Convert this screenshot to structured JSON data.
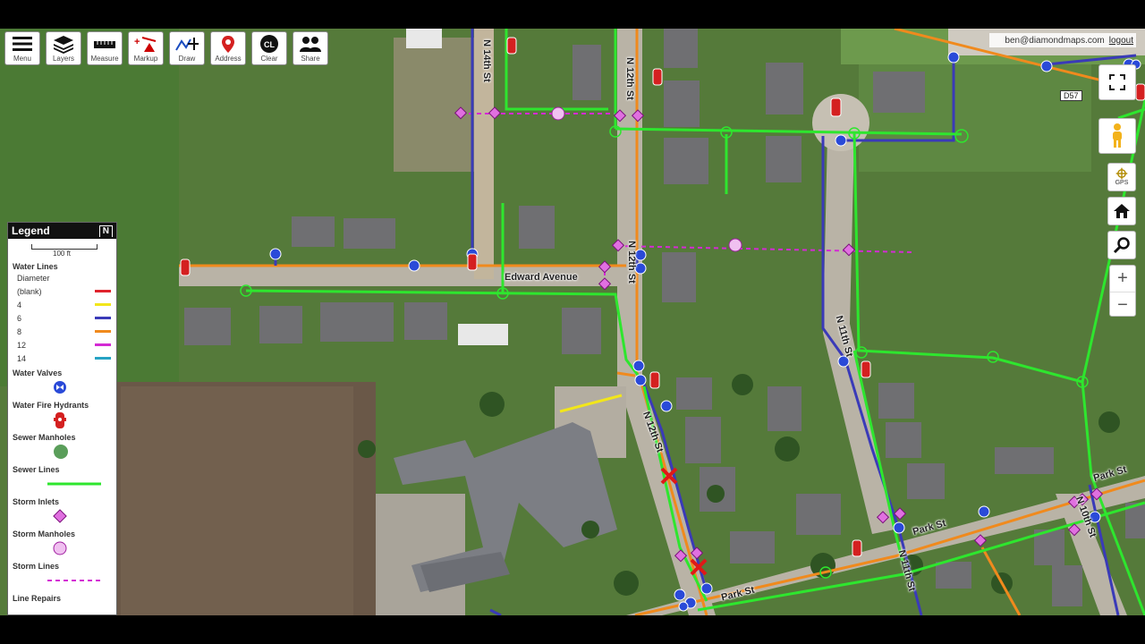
{
  "toolbar": [
    {
      "key": "menu",
      "label": "Menu"
    },
    {
      "key": "layers",
      "label": "Layers"
    },
    {
      "key": "measure",
      "label": "Measure"
    },
    {
      "key": "markup",
      "label": "Markup"
    },
    {
      "key": "draw",
      "label": "Draw"
    },
    {
      "key": "address",
      "label": "Address"
    },
    {
      "key": "clear",
      "label": "Clear"
    },
    {
      "key": "share",
      "label": "Share"
    }
  ],
  "user": {
    "email": "ben@diamondmaps.com",
    "logout": "logout"
  },
  "right_controls": {
    "gps_label": "GPS",
    "zoom_in": "+",
    "zoom_out": "−"
  },
  "legend": {
    "title": "Legend",
    "north": "N",
    "scale": "100 ft",
    "water_lines": "Water Lines",
    "diameter": "Diameter",
    "diameters": [
      {
        "label": "(blank)",
        "color": "#e0242d"
      },
      {
        "label": "4",
        "color": "#f2e61a"
      },
      {
        "label": "6",
        "color": "#3a3ab8"
      },
      {
        "label": "8",
        "color": "#f08a1d"
      },
      {
        "label": "12",
        "color": "#d42ad4"
      },
      {
        "label": "14",
        "color": "#26a3c4"
      }
    ],
    "water_valves": "Water Valves",
    "water_fire_hydrants": "Water Fire Hydrants",
    "sewer_manholes": "Sewer Manholes",
    "sewer_lines": "Sewer Lines",
    "storm_inlets": "Storm Inlets",
    "storm_manholes": "Storm Manholes",
    "storm_lines": "Storm Lines",
    "line_repairs": "Line Repairs"
  },
  "streets": {
    "edward": "Edward Avenue",
    "n14": "N 14th St",
    "n12": "N 12th St",
    "n12b": "N 12th St",
    "n12c": "N 12th St",
    "n11": "N 11th St",
    "n11b": "N 11th St",
    "n10": "N 10th St",
    "park1": "Park St",
    "park2": "Park St",
    "park3": "Park St"
  },
  "route_badge": "D57",
  "colors": {
    "sewer": "#2ee62e",
    "water6": "#3a3ab8",
    "water8": "#f08a1d",
    "water4": "#f2e61a",
    "storm": "#d42ad4",
    "hydrant": "#d42020",
    "valve": "#2a4ad8"
  }
}
